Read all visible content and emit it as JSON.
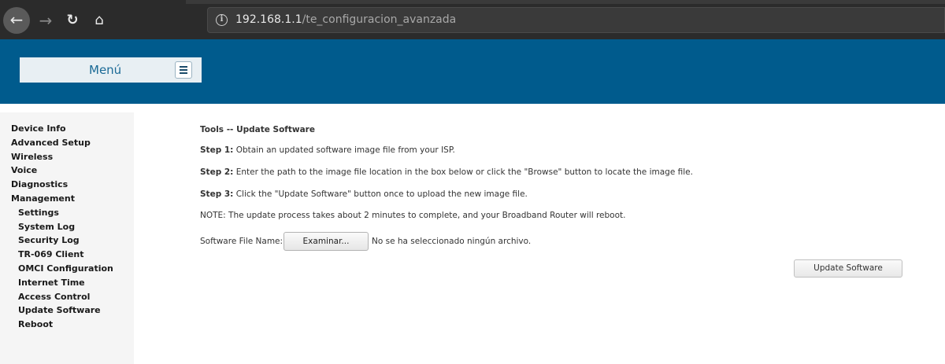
{
  "browser": {
    "url_host": "192.168.1.1",
    "url_path": "/te_configuracion_avanzada"
  },
  "header": {
    "menu_label": "Menú"
  },
  "sidebar": {
    "items": [
      {
        "label": "Device Info",
        "level": 0
      },
      {
        "label": "Advanced Setup",
        "level": 0
      },
      {
        "label": "Wireless",
        "level": 0
      },
      {
        "label": "Voice",
        "level": 0
      },
      {
        "label": "Diagnostics",
        "level": 0
      },
      {
        "label": "Management",
        "level": 0
      },
      {
        "label": "Settings",
        "level": 1
      },
      {
        "label": "System Log",
        "level": 1
      },
      {
        "label": "Security Log",
        "level": 1
      },
      {
        "label": "TR-069 Client",
        "level": 1
      },
      {
        "label": "OMCI Configuration",
        "level": 1
      },
      {
        "label": "Internet Time",
        "level": 1
      },
      {
        "label": "Access Control",
        "level": 1
      },
      {
        "label": "Update Software",
        "level": 1
      },
      {
        "label": "Reboot",
        "level": 1
      }
    ]
  },
  "main": {
    "title": "Tools -- Update Software",
    "step1_label": "Step 1:",
    "step1_text": " Obtain an updated software image file from your ISP.",
    "step2_label": "Step 2:",
    "step2_text": " Enter the path to the image file location in the box below or click the \"Browse\" button to locate the image file.",
    "step3_label": "Step 3:",
    "step3_text": " Click the \"Update Software\" button once to upload the new image file.",
    "note": "NOTE: The update process takes about 2 minutes to complete, and your Broadband Router will reboot.",
    "file_label": "Software File Name:",
    "browse_label": "Examinar...",
    "no_file_text": "No se ha seleccionado ningún archivo.",
    "update_label": "Update Software"
  }
}
